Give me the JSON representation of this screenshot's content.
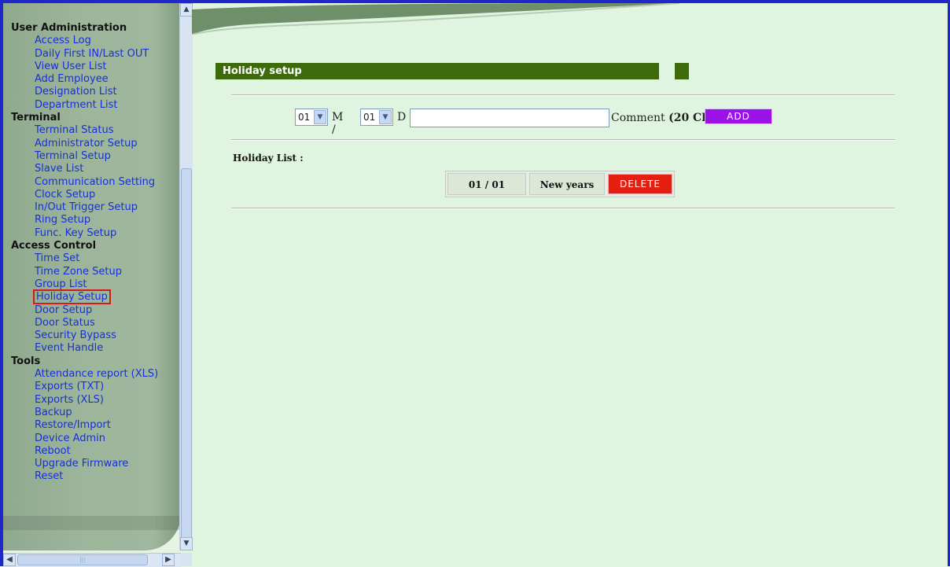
{
  "sidebar": {
    "sections": [
      {
        "title": "User Administration",
        "items": [
          "Access Log",
          "Daily First IN/Last OUT",
          "View User List",
          "Add Employee",
          "Designation List",
          "Department List"
        ]
      },
      {
        "title": "Terminal",
        "items": [
          "Terminal Status",
          "Administrator Setup",
          "Terminal Setup",
          "Slave List",
          "Communication Setting",
          "Clock Setup",
          "In/Out Trigger Setup",
          "Ring Setup",
          "Func. Key Setup"
        ]
      },
      {
        "title": "Access Control",
        "items": [
          "Time Set",
          "Time Zone Setup",
          "Group List",
          "Holiday Setup",
          "Door Setup",
          "Door Status",
          "Security Bypass",
          "Event Handle"
        ]
      },
      {
        "title": "Tools",
        "items": [
          "Attendance report (XLS)",
          "Exports (TXT)",
          "Exports (XLS)",
          "Backup",
          "Restore/Import",
          "Device Admin",
          "Reboot",
          "Upgrade Firmware",
          "Reset"
        ]
      }
    ],
    "active_item": "Holiday Setup"
  },
  "page": {
    "title": "Holiday setup"
  },
  "form": {
    "month_value": "01",
    "month_suffix": "M /",
    "day_value": "01",
    "day_suffix": "D",
    "comment_value": "",
    "comment_label_prefix": "Comment",
    "comment_label_hint": "(20 Char. Max)",
    "add_label": "ADD"
  },
  "holiday_list": {
    "label": "Holiday List :",
    "rows": [
      {
        "date": "01 / 01",
        "comment": "New years",
        "delete_label": "DELETE"
      }
    ]
  },
  "colors": {
    "title_bar": "#3d6b0c",
    "add_button": "#9b12e6",
    "delete_button": "#e51f10",
    "link": "#1730d8",
    "content_bg": "#dff5df"
  }
}
